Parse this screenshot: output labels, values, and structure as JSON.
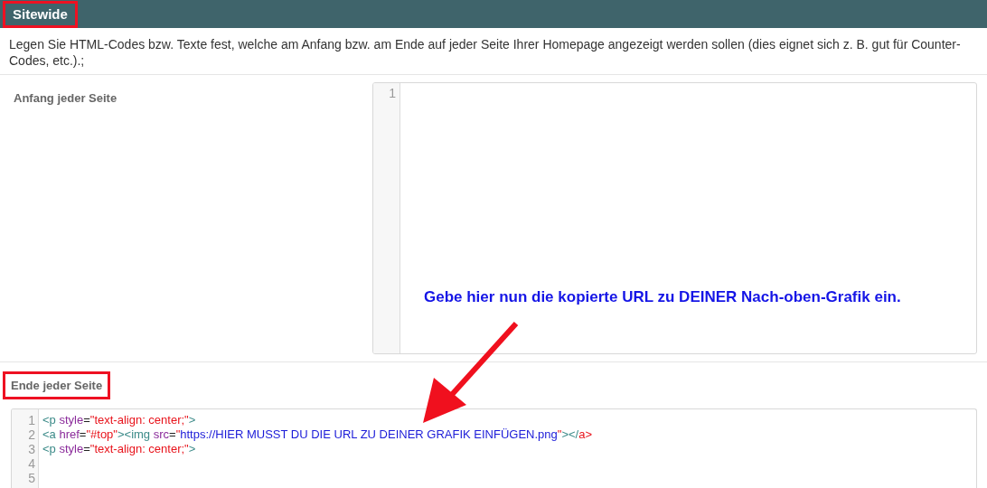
{
  "header": {
    "title": "Sitewide",
    "highlighted": true
  },
  "description": "Legen Sie HTML-Codes bzw. Texte fest, welche am Anfang bzw. am Ende auf jeder Seite Ihrer Homepage angezeigt werden sollen (dies eignet sich z. B. gut für Counter-Codes, etc.).;",
  "fields": [
    {
      "label": "Anfang jeder Seite",
      "highlighted": false,
      "kind": "side",
      "editor": {
        "lines": [
          {
            "number": "1"
          }
        ]
      }
    },
    {
      "label": "Ende jeder Seite",
      "highlighted": true,
      "kind": "stacked",
      "editor": {
        "lines": [
          {
            "number": "1",
            "tokens": [
              {
                "kind": "tag",
                "text": "<p"
              },
              {
                "kind": "attr",
                "text": " style"
              },
              {
                "kind": "punct",
                "text": "="
              },
              {
                "kind": "string",
                "text": "\"text-align: center;\""
              },
              {
                "kind": "tag",
                "text": ">"
              }
            ]
          },
          {
            "number": "2",
            "tokens": [
              {
                "kind": "tag",
                "text": "<a"
              },
              {
                "kind": "attr",
                "text": " href"
              },
              {
                "kind": "punct",
                "text": "="
              },
              {
                "kind": "string",
                "text": "\"#top\""
              },
              {
                "kind": "tag",
                "text": "><img"
              },
              {
                "kind": "attr",
                "text": " src"
              },
              {
                "kind": "punct",
                "text": "="
              },
              {
                "kind": "string",
                "text": "\""
              },
              {
                "kind": "url",
                "text": "https://HIER MUSST DU DIE URL ZU DEINER GRAFIK EINFÜGEN.png"
              },
              {
                "kind": "string",
                "text": "\""
              },
              {
                "kind": "tag",
                "text": "></"
              },
              {
                "kind": "string",
                "text": "a>"
              }
            ]
          },
          {
            "number": "3",
            "tokens": [
              {
                "kind": "tag",
                "text": "<p"
              },
              {
                "kind": "attr",
                "text": " style"
              },
              {
                "kind": "punct",
                "text": "="
              },
              {
                "kind": "string",
                "text": "\"text-align: center;\""
              },
              {
                "kind": "tag",
                "text": ">"
              }
            ]
          },
          {
            "number": "4"
          },
          {
            "number": "5"
          }
        ]
      }
    }
  ],
  "annotation": {
    "text": "Gebe hier nun die kopierte URL zu DEINER Nach-oben-Grafik ein."
  }
}
